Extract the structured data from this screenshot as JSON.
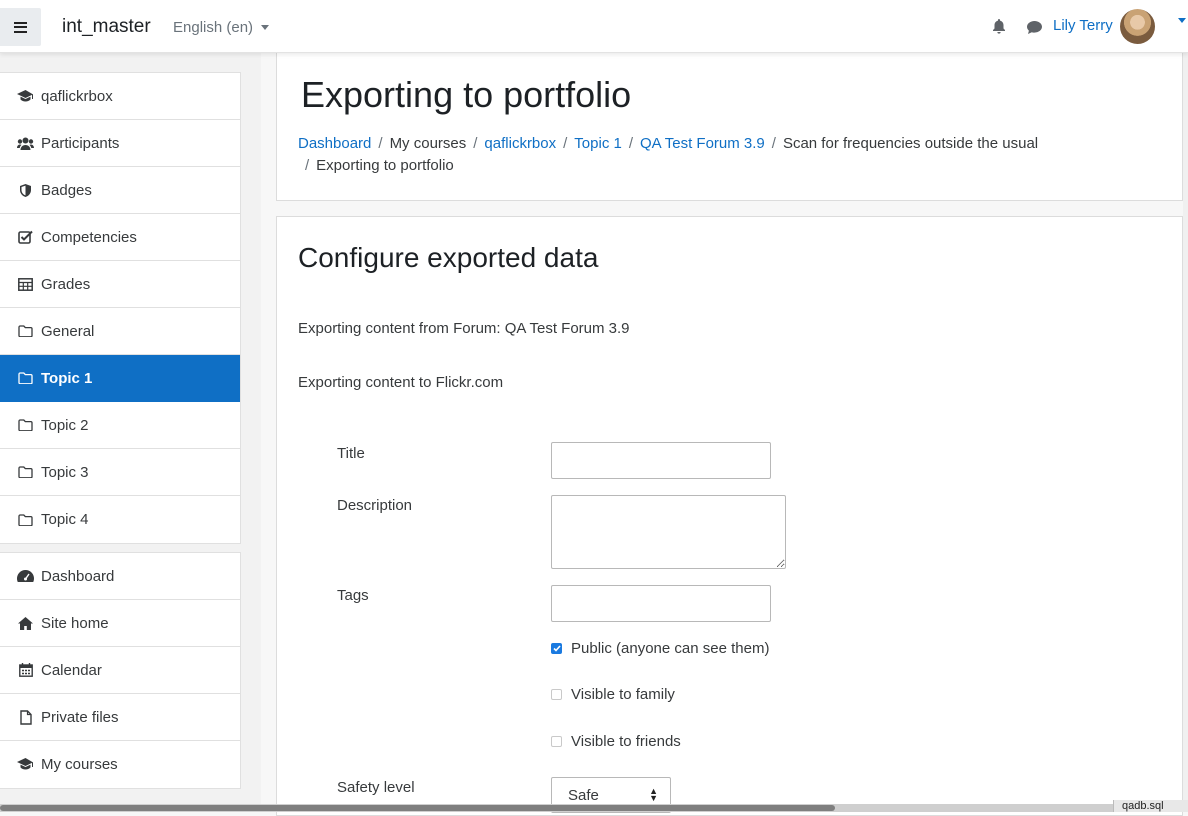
{
  "navbar": {
    "site_name": "int_master",
    "language": "English (en)",
    "user_name": "Lily Terry"
  },
  "drawer": {
    "course_items": [
      {
        "label": "qaflickrbox",
        "icon": "graduation-cap-icon"
      },
      {
        "label": "Participants",
        "icon": "users-icon"
      },
      {
        "label": "Badges",
        "icon": "shield-icon"
      },
      {
        "label": "Competencies",
        "icon": "check-square-icon"
      },
      {
        "label": "Grades",
        "icon": "table-icon"
      },
      {
        "label": "General",
        "icon": "folder-icon"
      },
      {
        "label": "Topic 1",
        "icon": "folder-icon",
        "active": true
      },
      {
        "label": "Topic 2",
        "icon": "folder-icon"
      },
      {
        "label": "Topic 3",
        "icon": "folder-icon"
      },
      {
        "label": "Topic 4",
        "icon": "folder-icon"
      }
    ],
    "site_items": [
      {
        "label": "Dashboard",
        "icon": "tachometer-icon"
      },
      {
        "label": "Site home",
        "icon": "home-icon"
      },
      {
        "label": "Calendar",
        "icon": "calendar-icon"
      },
      {
        "label": "Private files",
        "icon": "file-icon"
      },
      {
        "label": "My courses",
        "icon": "graduation-cap-icon"
      }
    ]
  },
  "header": {
    "title": "Exporting to portfolio",
    "breadcrumb": {
      "dashboard": "Dashboard",
      "my_courses": "My courses",
      "course": "qaflickrbox",
      "topic": "Topic 1",
      "forum": "QA Test Forum 3.9",
      "discussion": "Scan for frequencies outside the usual",
      "current": "Exporting to portfolio"
    }
  },
  "main": {
    "section_title": "Configure exported data",
    "from_text": "Exporting content from Forum: QA Test Forum 3.9",
    "to_text": "Exporting content to Flickr.com",
    "form": {
      "title_label": "Title",
      "title_value": "",
      "description_label": "Description",
      "description_value": "",
      "tags_label": "Tags",
      "tags_value": "",
      "public_label": "Public (anyone can see them)",
      "public_checked": true,
      "family_label": "Visible to family",
      "family_checked": false,
      "friends_label": "Visible to friends",
      "friends_checked": false,
      "safety_label": "Safety level",
      "safety_value": "Safe"
    }
  },
  "status_bar": {
    "file_name": "qadb.sql"
  },
  "colors": {
    "accent": "#0f6fc5",
    "active_nav": "#0f6fc5",
    "checkbox": "#1a7ae0"
  }
}
